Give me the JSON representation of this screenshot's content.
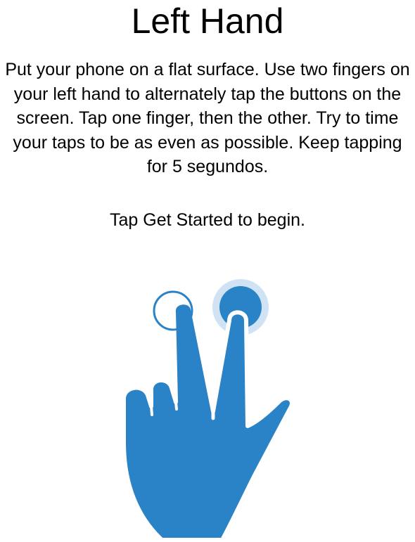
{
  "screen": {
    "title": "Left Hand",
    "instructions": "Put your phone on a flat surface. Use two fingers on your left hand to alternately tap the buttons on the screen. Tap one finger, then the other. Try to time your taps to be as even as possible. Keep tapping for 5 segundos.",
    "prompt": "Tap Get Started to begin."
  },
  "illustration": {
    "icon": "two-finger-tap-hand-icon",
    "color": "#2A83C7",
    "halo_color": "#CFE3F4"
  }
}
